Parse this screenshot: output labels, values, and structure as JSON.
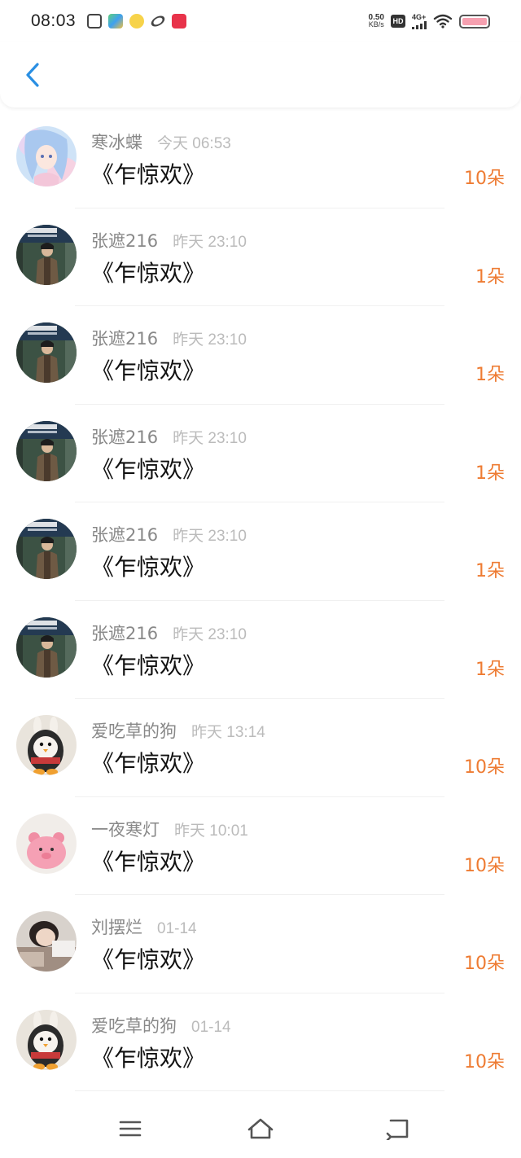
{
  "status_bar": {
    "time": "08:03",
    "net_speed_value": "0.50",
    "net_speed_unit": "KB/s",
    "hd_badge": "HD",
    "signal_label": "4G+",
    "app_icons": [
      "scissors-app-icon",
      "game-app-icon",
      "mascot-app-icon",
      "link-app-icon",
      "red-app-icon"
    ]
  },
  "header": {
    "back_icon": "chevron-left-icon",
    "accent_color": "#2a8fe3"
  },
  "list": {
    "count_color": "#ee7b32",
    "items": [
      {
        "user": "寒冰蝶",
        "time": "今天 06:53",
        "gift": "《乍惊欢》",
        "count": "10朵",
        "avatar": "anime-girl-avatar"
      },
      {
        "user": "张遮216",
        "time": "昨天 23:10",
        "gift": "《乍惊欢》",
        "count": "1朵",
        "avatar": "drama-poster-avatar"
      },
      {
        "user": "张遮216",
        "time": "昨天 23:10",
        "gift": "《乍惊欢》",
        "count": "1朵",
        "avatar": "drama-poster-avatar"
      },
      {
        "user": "张遮216",
        "time": "昨天 23:10",
        "gift": "《乍惊欢》",
        "count": "1朵",
        "avatar": "drama-poster-avatar"
      },
      {
        "user": "张遮216",
        "time": "昨天 23:10",
        "gift": "《乍惊欢》",
        "count": "1朵",
        "avatar": "drama-poster-avatar"
      },
      {
        "user": "张遮216",
        "time": "昨天 23:10",
        "gift": "《乍惊欢》",
        "count": "1朵",
        "avatar": "drama-poster-avatar"
      },
      {
        "user": "爱吃草的狗",
        "time": "昨天 13:14",
        "gift": "《乍惊欢》",
        "count": "10朵",
        "avatar": "penguin-plush-avatar"
      },
      {
        "user": "一夜寒灯",
        "time": "昨天 10:01",
        "gift": "《乍惊欢》",
        "count": "10朵",
        "avatar": "pink-plush-avatar"
      },
      {
        "user": "刘摆烂",
        "time": "01-14",
        "gift": "《乍惊欢》",
        "count": "10朵",
        "avatar": "girl-photo-avatar"
      },
      {
        "user": "爱吃草的狗",
        "time": "01-14",
        "gift": "《乍惊欢》",
        "count": "10朵",
        "avatar": "penguin-plush-avatar"
      }
    ]
  },
  "bottom_nav": {
    "menu_icon": "menu-icon",
    "home_icon": "home-icon",
    "back_icon": "back-arrow-icon"
  }
}
